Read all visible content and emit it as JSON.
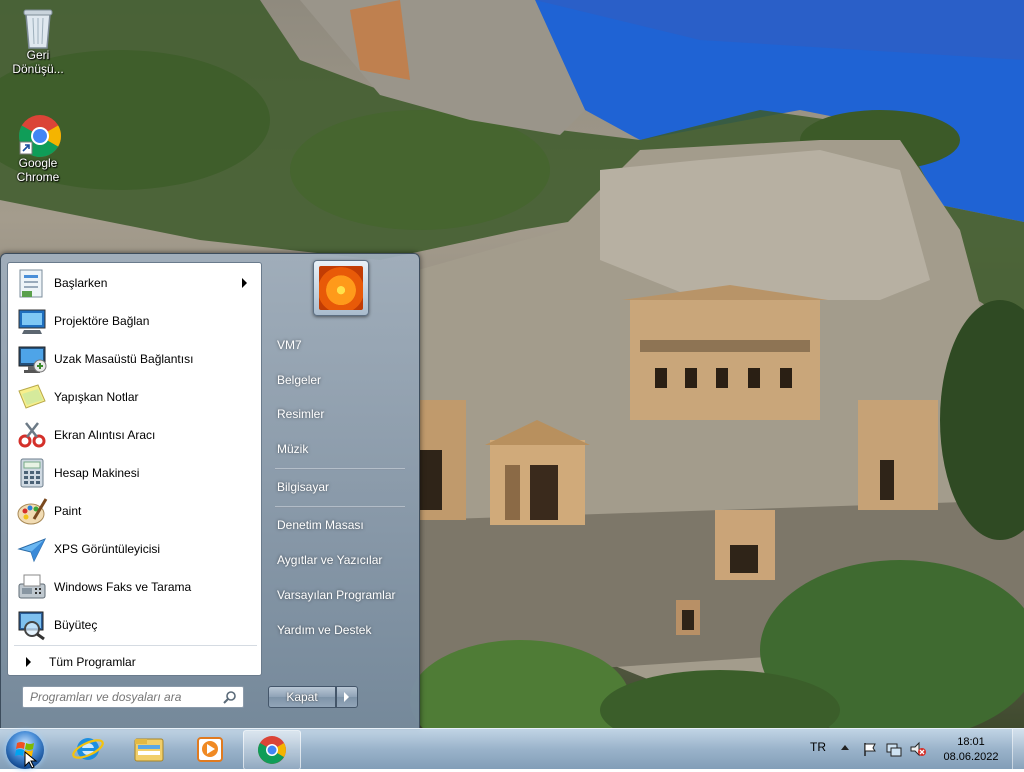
{
  "desktop": {
    "icons": [
      {
        "label": "Geri Dönüşü..."
      },
      {
        "label": "Google Chrome"
      }
    ]
  },
  "start_menu": {
    "programs": [
      {
        "label": "Başlarken",
        "icon": "getting-started-icon",
        "has_submenu": true
      },
      {
        "label": "Projektöre Bağlan",
        "icon": "projector-icon"
      },
      {
        "label": "Uzak Masaüstü Bağlantısı",
        "icon": "remote-desktop-icon"
      },
      {
        "label": "Yapışkan Notlar",
        "icon": "sticky-notes-icon"
      },
      {
        "label": "Ekran Alıntısı Aracı",
        "icon": "snipping-tool-icon"
      },
      {
        "label": "Hesap Makinesi",
        "icon": "calculator-icon"
      },
      {
        "label": "Paint",
        "icon": "paint-icon"
      },
      {
        "label": "XPS Görüntüleyicisi",
        "icon": "xps-viewer-icon"
      },
      {
        "label": "Windows Faks ve Tarama",
        "icon": "fax-scan-icon"
      },
      {
        "label": "Büyüteç",
        "icon": "magnifier-icon"
      }
    ],
    "all_programs": "Tüm Programlar",
    "search_placeholder": "Programları ve dosyaları ara",
    "right_links": [
      {
        "label": "VM7"
      },
      {
        "label": "Belgeler"
      },
      {
        "label": "Resimler"
      },
      {
        "label": "Müzik"
      },
      {
        "label": "Bilgisayar"
      },
      {
        "label": "Denetim Masası"
      },
      {
        "label": "Aygıtlar ve Yazıcılar"
      },
      {
        "label": "Varsayılan Programlar"
      },
      {
        "label": "Yardım ve Destek"
      }
    ],
    "shutdown_label": "Kapat"
  },
  "taskbar": {
    "pinned": [
      "internet-explorer-icon",
      "explorer-icon",
      "media-player-icon",
      "chrome-icon"
    ],
    "language": "TR",
    "time": "18:01",
    "date": "08.06.2022"
  },
  "colors": {
    "accent": "#4b8fd8",
    "taskbar": "#96b0c8"
  }
}
